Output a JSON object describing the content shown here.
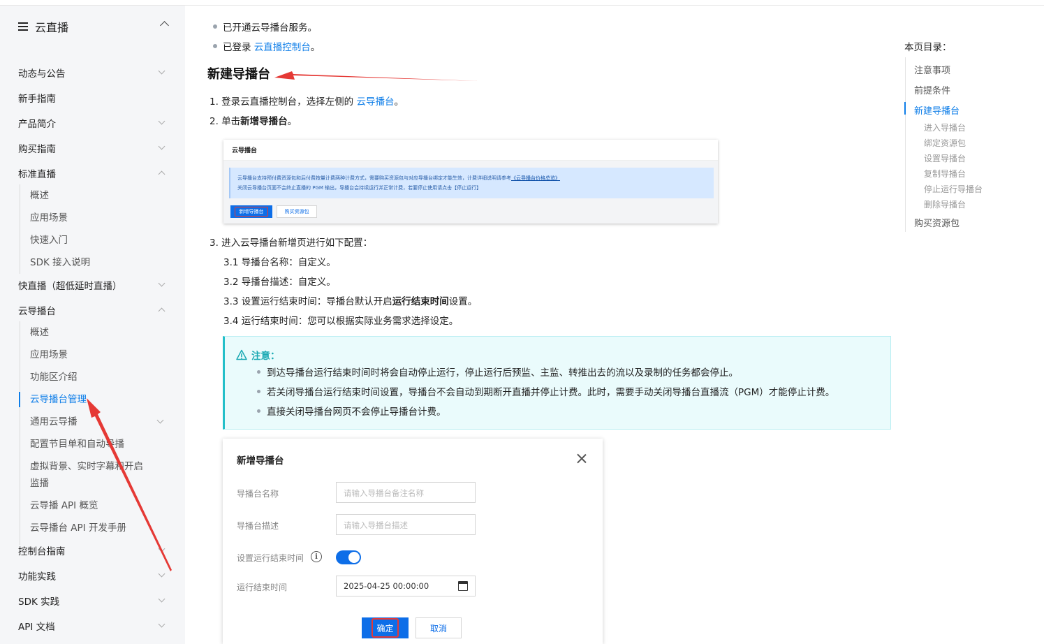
{
  "sidebar": {
    "title": "云直播",
    "items": [
      {
        "label": "动态与公告"
      },
      {
        "label": "新手指南"
      },
      {
        "label": "产品简介"
      },
      {
        "label": "购买指南"
      },
      {
        "label": "标准直播"
      },
      {
        "label": "快直播（超低延时直播）"
      },
      {
        "label": "云导播台"
      },
      {
        "label": "控制台指南"
      },
      {
        "label": "功能实践"
      },
      {
        "label": "SDK 实践"
      },
      {
        "label": "API 文档"
      }
    ],
    "standard_live_sub": [
      "概述",
      "应用场景",
      "快速入门",
      "SDK 接入说明"
    ],
    "director_sub": [
      "概述",
      "应用场景",
      "功能区介绍",
      "云导播台管理",
      "通用云导播",
      "配置节目单和自动导播",
      "虚拟背景、实时字幕和开启",
      "监播",
      "云导播 API 概览",
      "云导播台 API 开发手册"
    ]
  },
  "content": {
    "prereq1": "已开通云导播台服务。",
    "prereq2_prefix": "已登录",
    "prereq2_link": "云直播控制台",
    "prereq2_suffix": "。",
    "section_title": "新建导播台",
    "step1_prefix": "1. 登录云直播控制台，选择左侧的",
    "step1_link": "云导播台",
    "step1_suffix": "。",
    "step2_prefix": "2. 单击",
    "step2_bold": "新增导播台",
    "step2_suffix": "。",
    "step3": "3. 进入云导播台新增页进行如下配置：",
    "sub1": "3.1  导播台名称：自定义。",
    "sub2": "3.2  导播台描述：自定义。",
    "sub3_prefix": "3.3  设置运行结束时间：导播台默认开启",
    "sub3_bold": "运行结束时间",
    "sub3_suffix": "设置。",
    "sub4": "3.4  运行结束时间：您可以根据实际业务需求选择设定。"
  },
  "mini": {
    "title": "云导播台",
    "notice1": "云导播台支持预付费资源包和后付费按量计费两种计费方式，需要购买资源包与对应导播台绑定才能生效，计费详细说明请参考",
    "notice1_link": "《云导播台价格总览》",
    "notice2": "关闭云导播台页面不会终止直播的 PGM 输出，导播台会持续运行并正常计费，若要停止使用请点击【停止运行】",
    "btn_new": "新增导播台",
    "btn_buy": "购买资源包"
  },
  "note": {
    "title": "注意：",
    "items": [
      "到达导播台运行结束时间时将会自动停止运行，停止运行后预监、主监、转推出去的流以及录制的任务都会停止。",
      "若关闭导播台运行结束时间设置，导播台不会自动到期断开直播并停止计费。此时，需要手动关闭导播台直播流（PGM）才能停止计费。",
      "直接关闭导播台网页不会停止导播台计费。"
    ]
  },
  "dialog": {
    "title": "新增导播台",
    "name_label": "导播台名称",
    "name_placeholder": "请输入导播台备注名称",
    "desc_label": "导播台描述",
    "desc_placeholder": "请输入导播台描述",
    "endtime_toggle_label": "设置运行结束时间",
    "toggle_on": true,
    "endtime_label": "运行结束时间",
    "endtime_value": "2025-04-25 00:00:00",
    "ok": "确定",
    "cancel": "取消"
  },
  "toc": {
    "title": "本页目录：",
    "items": [
      "注意事项",
      "前提条件",
      "新建导播台"
    ],
    "sub": [
      "进入导播台",
      "绑定资源包",
      "设置导播台",
      "复制导播台",
      "停止运行导播台",
      "删除导播台"
    ],
    "last": "购买资源包"
  },
  "colors": {
    "accent": "#0d7de8",
    "annotation": "#e53935",
    "note_border": "#23bfc9"
  }
}
